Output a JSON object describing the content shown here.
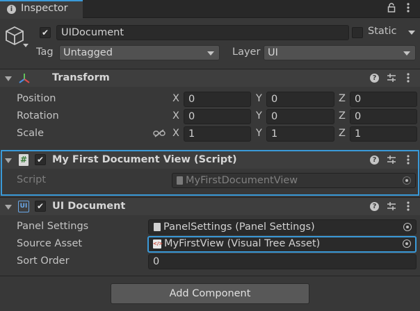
{
  "tab": {
    "title": "Inspector"
  },
  "object": {
    "name": "UIDocument",
    "static_label": "Static",
    "tag_label": "Tag",
    "tag_value": "Untagged",
    "layer_label": "Layer",
    "layer_value": "UI"
  },
  "transform": {
    "title": "Transform",
    "rows": [
      {
        "label": "Position",
        "x": "0",
        "y": "0",
        "z": "0"
      },
      {
        "label": "Rotation",
        "x": "0",
        "y": "0",
        "z": "0"
      },
      {
        "label": "Scale",
        "x": "1",
        "y": "1",
        "z": "1"
      }
    ],
    "axes": {
      "x": "X",
      "y": "Y",
      "z": "Z"
    }
  },
  "script_component": {
    "title": "My First Document View (Script)",
    "script_label": "Script",
    "script_value": "MyFirstDocumentView"
  },
  "ui_document": {
    "title": "UI Document",
    "panel_settings_label": "Panel Settings",
    "panel_settings_value": "PanelSettings (Panel Settings)",
    "source_asset_label": "Source Asset",
    "source_asset_value": "MyFirstView (Visual Tree Asset)",
    "sort_order_label": "Sort Order",
    "sort_order_value": "0"
  },
  "footer": {
    "add_component_label": "Add Component"
  },
  "colors": {
    "background": "#383838",
    "highlight": "#3a9ad9",
    "field": "#2a2a2a"
  }
}
